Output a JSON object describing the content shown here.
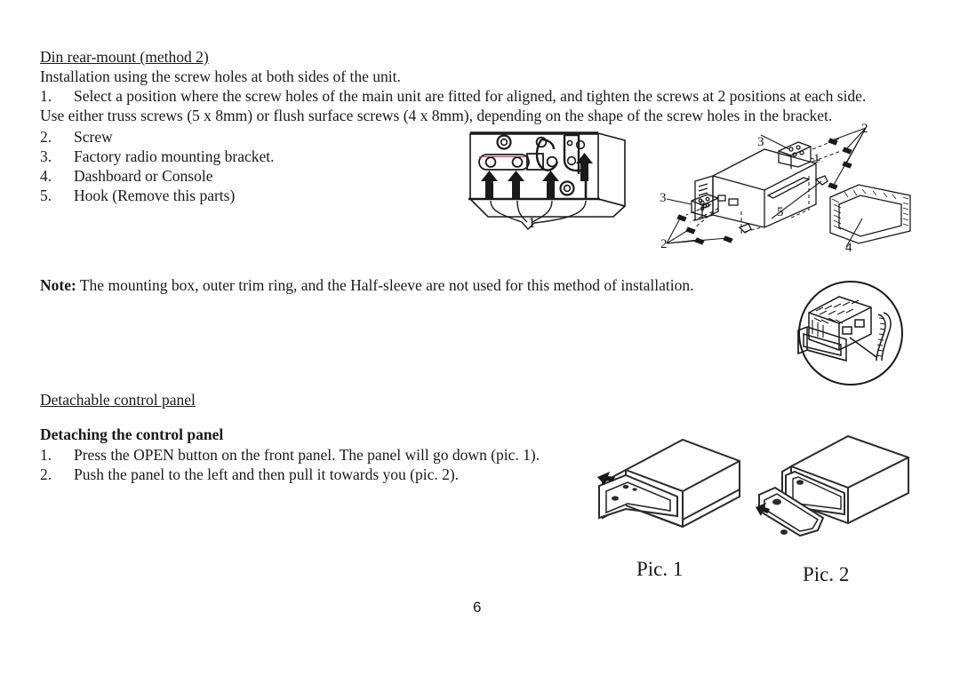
{
  "document": {
    "page_number": "6",
    "section_1": {
      "heading": "Din rear-mount (method 2)",
      "intro": "Installation using the screw holes at both sides of the unit.",
      "items": [
        {
          "num": "1.",
          "text": "Select a position where the screw holes of the main unit are fitted for aligned, and tighten the screws at 2 positions at each side."
        },
        {
          "num": "2.",
          "text": "Screw"
        },
        {
          "num": "3.",
          "text": "Factory radio mounting bracket."
        },
        {
          "num": "4.",
          "text": "Dashboard or Console"
        },
        {
          "num": "5.",
          "text": "Hook (Remove this parts)"
        }
      ],
      "continuation": "Use either truss screws (5 x 8mm) or flush surface screws (4 x 8mm), depending on the shape of the screw holes in the bracket."
    },
    "note": {
      "label": "Note:",
      "text": " The mounting box, outer trim ring, and the Half-sleeve are not used for this method of installation."
    },
    "section_2": {
      "heading": "Detachable control panel",
      "subheading": "Detaching the control panel",
      "items": [
        {
          "num": "1.",
          "text": "Press the OPEN button on the front panel. The panel will go down (pic. 1)."
        },
        {
          "num": "2.",
          "text": "Push the panel to the left and then pull it towards you (pic. 2)."
        }
      ]
    },
    "figures": {
      "bracket_detail": {
        "caption_number": "1"
      },
      "exploded_view": {
        "callouts": [
          "2",
          "3",
          "1",
          "3",
          "5",
          "2",
          "4"
        ]
      },
      "note_circle": {},
      "pic1": {
        "label": "Pic. 1"
      },
      "pic2": {
        "label": "Pic. 2"
      }
    }
  }
}
